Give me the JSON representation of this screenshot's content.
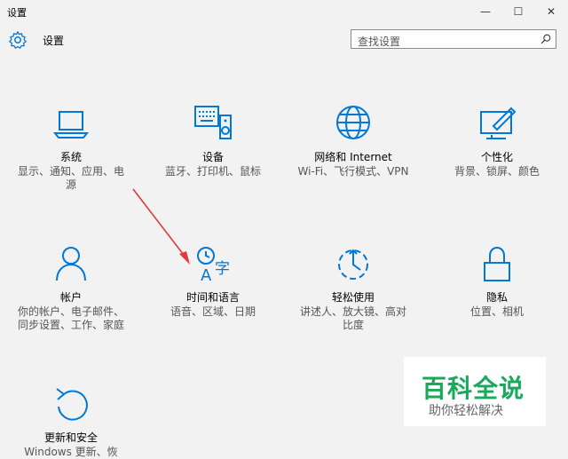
{
  "window": {
    "title": "设置",
    "min": "—",
    "max": "☐",
    "close": "✕"
  },
  "header": {
    "title": "设置"
  },
  "search": {
    "placeholder": "查找设置"
  },
  "tiles": [
    {
      "name": "系统",
      "desc": "显示、通知、应用、电\n源",
      "icon": "laptop-icon"
    },
    {
      "name": "设备",
      "desc": "蓝牙、打印机、鼠标",
      "icon": "keyboard-speaker-icon"
    },
    {
      "name": "网络和 Internet",
      "desc": "Wi-Fi、飞行模式、VPN",
      "icon": "globe-icon"
    },
    {
      "name": "个性化",
      "desc": "背景、锁屏、颜色",
      "icon": "paint-icon"
    },
    {
      "name": "帐户",
      "desc": "你的帐户、电子邮件、\n同步设置、工作、家庭",
      "icon": "person-icon"
    },
    {
      "name": "时间和语言",
      "desc": "语音、区域、日期",
      "icon": "time-language-icon"
    },
    {
      "name": "轻松使用",
      "desc": "讲述人、放大镜、高对\n比度",
      "icon": "ease-of-access-icon"
    },
    {
      "name": "隐私",
      "desc": "位置、相机",
      "icon": "lock-icon"
    },
    {
      "name": "更新和安全",
      "desc": "Windows 更新、恢",
      "icon": "refresh-icon"
    }
  ],
  "watermark": {
    "main": "百科全说",
    "sub": "助你轻松解决"
  },
  "colors": {
    "accent": "#0078d7",
    "arrow": "#e03a3a",
    "watermark": "#1aa85b"
  }
}
